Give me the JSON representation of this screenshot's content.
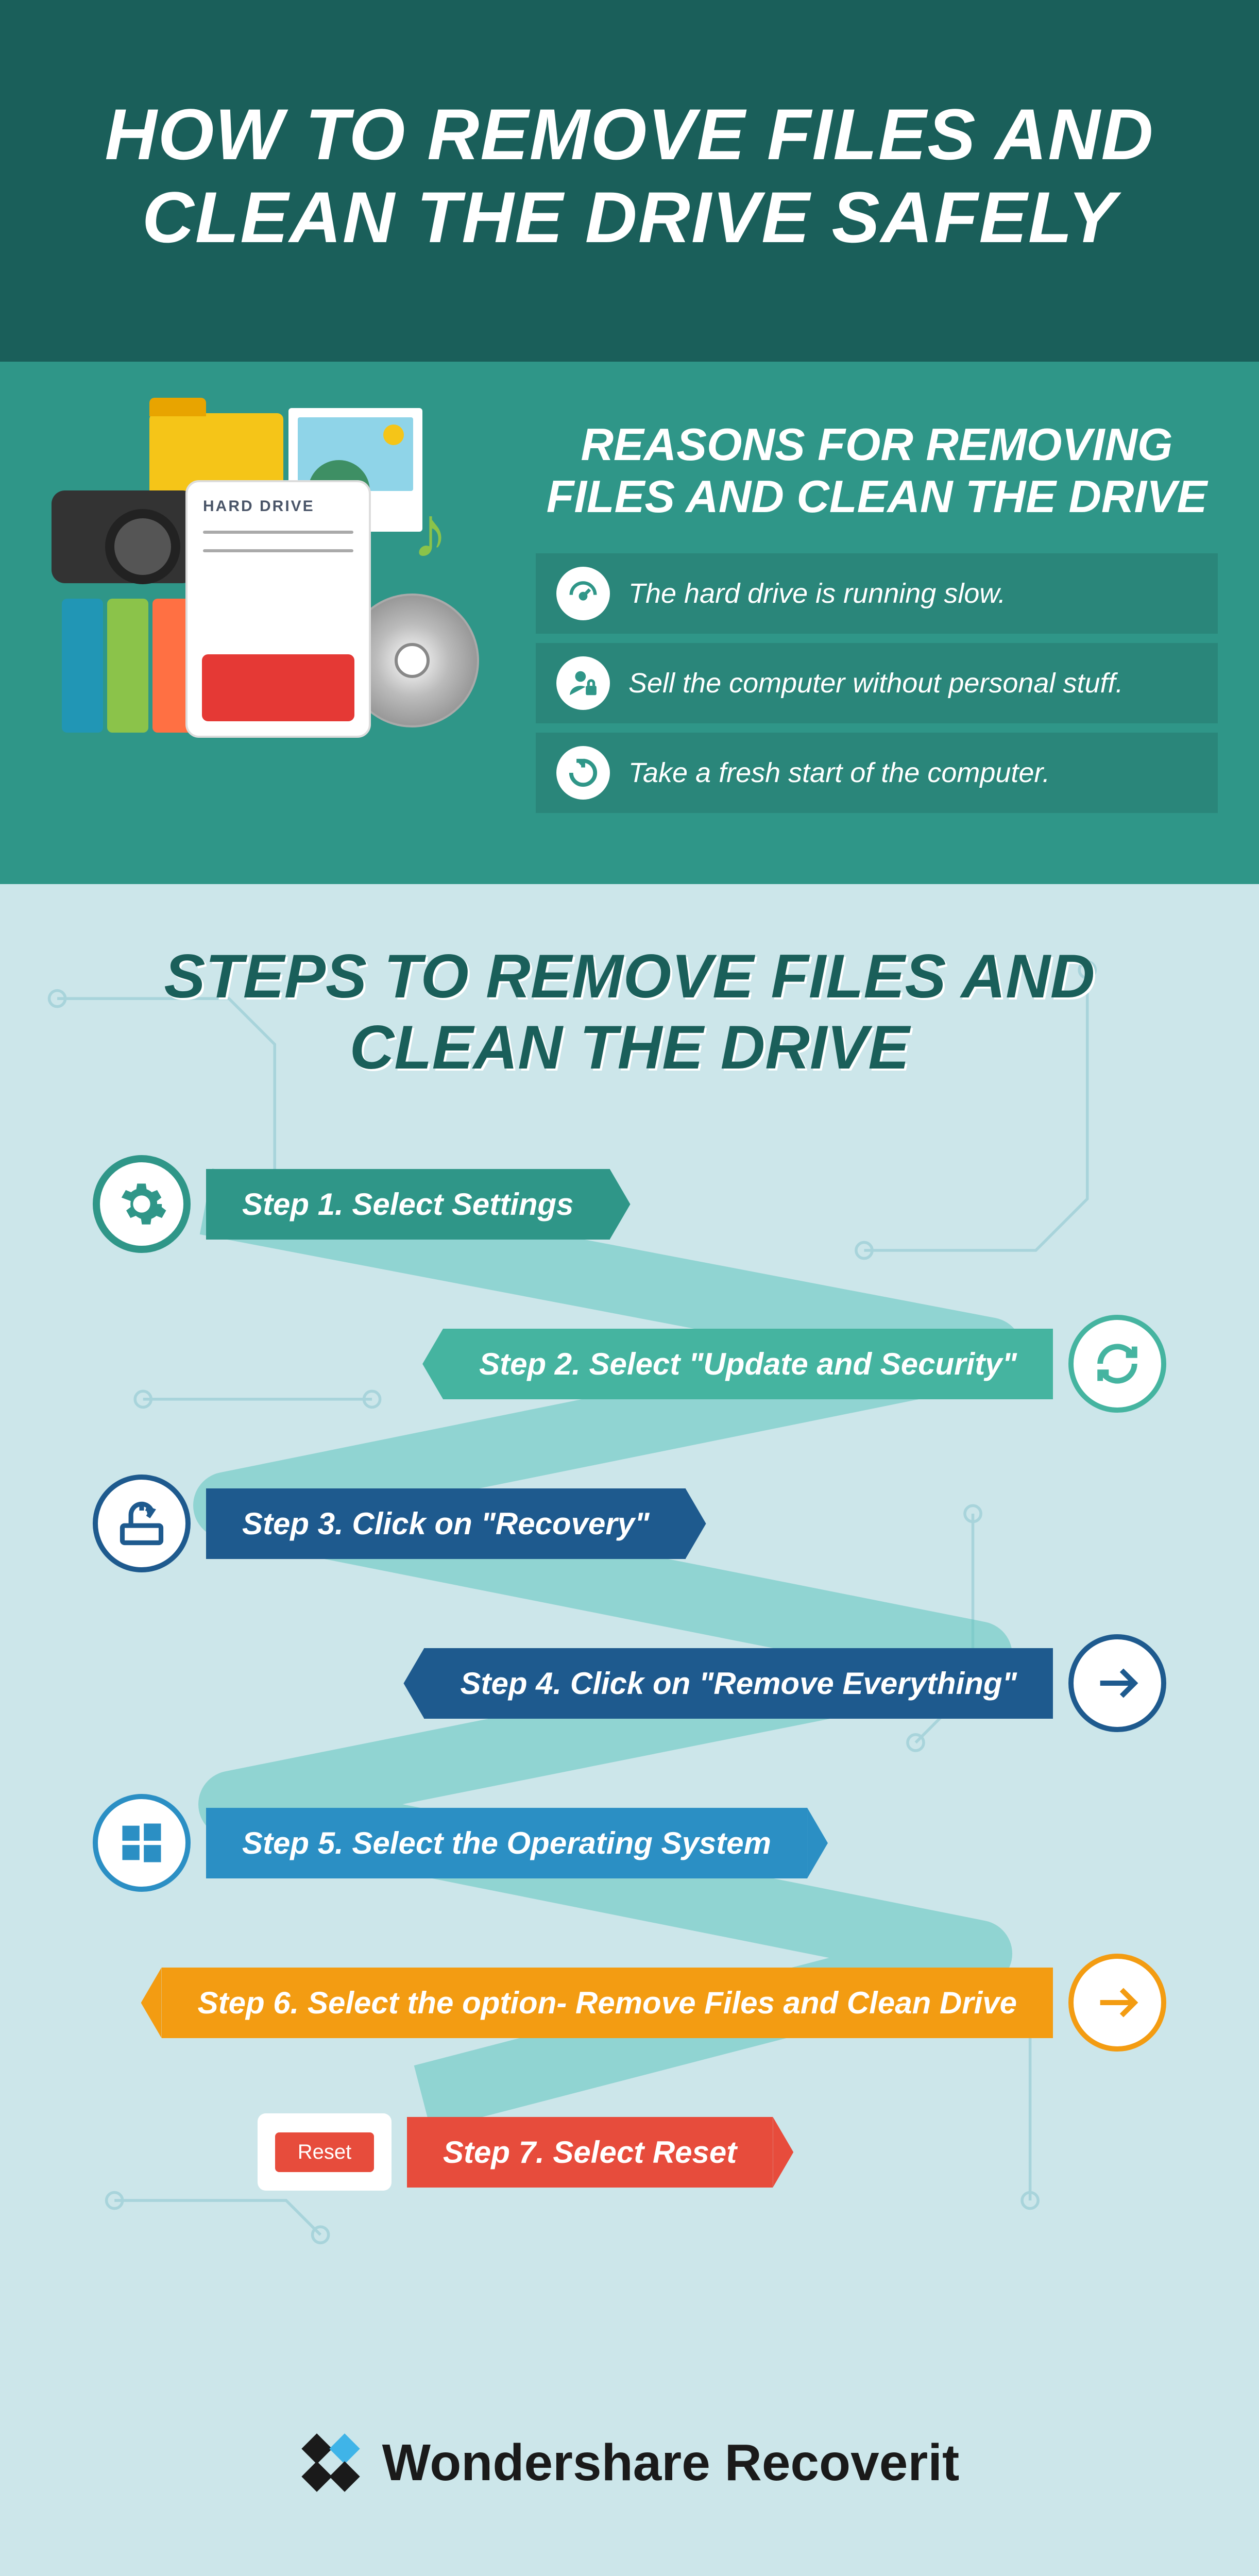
{
  "header": {
    "title": "HOW TO REMOVE FILES AND CLEAN THE DRIVE SAFELY"
  },
  "illustration": {
    "drive_label": "HARD DRIVE"
  },
  "reasons": {
    "heading": "REASONS FOR REMOVING FILES AND CLEAN THE DRIVE",
    "items": [
      {
        "text": "The hard drive is running slow.",
        "icon": "gauge-icon"
      },
      {
        "text": "Sell the computer without personal stuff.",
        "icon": "user-lock-icon"
      },
      {
        "text": "Take a fresh start of the computer.",
        "icon": "refresh-icon"
      }
    ]
  },
  "steps": {
    "heading": "STEPS TO REMOVE FILES AND CLEAN THE DRIVE",
    "items": [
      {
        "label": "Step 1. Select Settings",
        "icon": "gear-icon",
        "color": "green",
        "side": "left"
      },
      {
        "label": "Step 2. Select \"Update and Security\"",
        "icon": "sync-icon",
        "color": "teal",
        "side": "right"
      },
      {
        "label": "Step 3. Click on \"Recovery\"",
        "icon": "recovery-icon",
        "color": "darkblue",
        "side": "left"
      },
      {
        "label": "Step 4. Click on \"Remove Everything\"",
        "icon": "arrow-icon",
        "color": "darkblue",
        "side": "right"
      },
      {
        "label": "Step 5. Select the Operating System",
        "icon": "windows-icon",
        "color": "blue",
        "side": "left"
      },
      {
        "label": "Step 6. Select the option- Remove Files and Clean Drive",
        "icon": "arrow-icon",
        "color": "orange",
        "side": "right"
      },
      {
        "label": "Step 7. Select Reset",
        "icon": "reset-button",
        "color": "red",
        "side": "left",
        "button_text": "Reset"
      }
    ]
  },
  "footer": {
    "brand": "Wondershare Recoverit"
  }
}
